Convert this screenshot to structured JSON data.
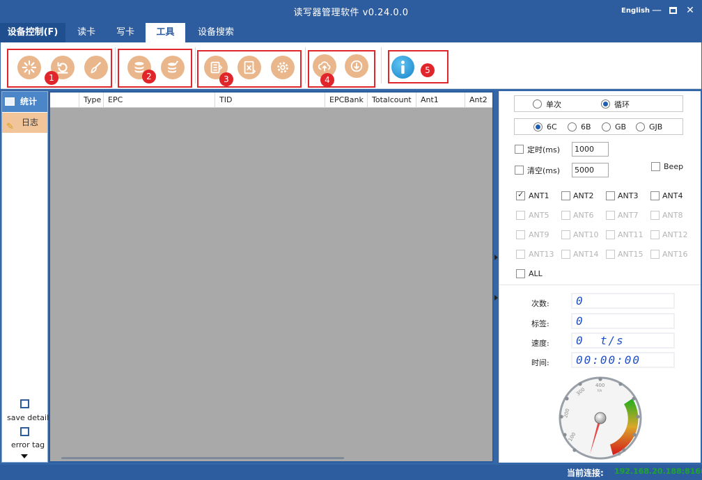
{
  "window": {
    "title": "读写器管理软件 v0.24.0.0",
    "language": "English"
  },
  "menu": [
    "设备控制(F)",
    "读卡",
    "写卡",
    "工具",
    "设备搜索"
  ],
  "toolbar": {
    "group_badges": [
      "1",
      "2",
      "3",
      "4",
      "5"
    ],
    "accent": "#e0262a",
    "icon_color": "#eab78d"
  },
  "leftnav": {
    "items": [
      "统计",
      "日志"
    ],
    "options": [
      "save detail",
      "error tag"
    ]
  },
  "table": {
    "columns": [
      "Type",
      "EPC",
      "TID",
      "EPCBank",
      "Totalcount",
      "Ant1",
      "Ant2"
    ]
  },
  "settings": {
    "mode": {
      "options": [
        "单次",
        "循环"
      ],
      "selected": "循环"
    },
    "protocol": {
      "options": [
        "6C",
        "6B",
        "GB",
        "GJB"
      ],
      "selected": "6C"
    },
    "timer_label": "定时(ms)",
    "timer_value": "1000",
    "clear_label": "清空(ms)",
    "clear_value": "5000",
    "beep_label": "Beep",
    "antennas": [
      "ANT1",
      "ANT2",
      "ANT3",
      "ANT4",
      "ANT5",
      "ANT6",
      "ANT7",
      "ANT8",
      "ANT9",
      "ANT10",
      "ANT11",
      "ANT12",
      "ANT13",
      "ANT14",
      "ANT15",
      "ANT16"
    ],
    "antenna_checked": "ANT1",
    "all_label": "ALL"
  },
  "stats": {
    "count_label": "次数:",
    "count_value": "0",
    "tags_label": "标签:",
    "tags_value": "0",
    "speed_label": "速度:",
    "speed_value": "0  t/s",
    "time_label": "时间:",
    "time_value": "00:00:00"
  },
  "gauge": {
    "ticks": [
      "0",
      "100",
      "200",
      "300",
      "400"
    ],
    "unit": "t/s",
    "value": 0
  },
  "status": {
    "connection_label": "当前连接:",
    "connection_value": "192.168.20.188:8160"
  }
}
